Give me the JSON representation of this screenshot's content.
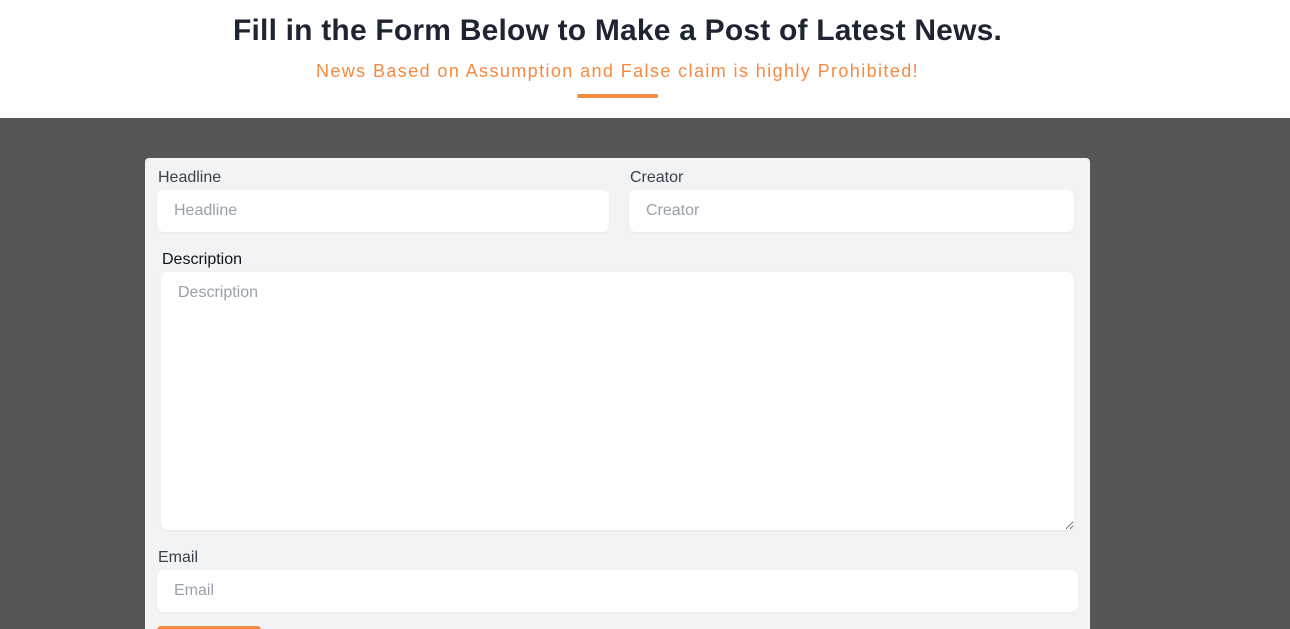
{
  "header": {
    "title": "Fill in the Form Below to Make a Post of Latest News.",
    "subtitle": "News Based on Assumption and False claim is highly Prohibited!"
  },
  "form": {
    "headline": {
      "label": "Headline",
      "placeholder": "Headline",
      "value": ""
    },
    "creator": {
      "label": "Creator",
      "placeholder": "Creator",
      "value": ""
    },
    "description": {
      "label": "Description",
      "placeholder": "Description",
      "value": ""
    },
    "email": {
      "label": "Email",
      "placeholder": "Email",
      "value": ""
    }
  },
  "colors": {
    "accent": "#f48a42",
    "backdrop": "#565656",
    "card": "#f2f3f5",
    "title": "#1f2433"
  }
}
